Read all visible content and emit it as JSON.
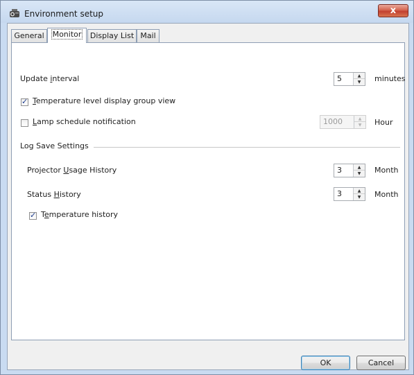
{
  "window": {
    "title": "Environment setup",
    "close_label": "x"
  },
  "tabs": [
    {
      "label": "General"
    },
    {
      "label": "Monitor"
    },
    {
      "label": "Display List"
    },
    {
      "label": "Mail"
    }
  ],
  "active_tab": "Monitor",
  "monitor": {
    "update_interval": {
      "label": "Update interval",
      "value": "5",
      "unit": "minutes"
    },
    "temperature_group_view": {
      "label": "Temperature level display group view",
      "checked": true
    },
    "lamp_schedule": {
      "label": "Lamp schedule notification",
      "checked": false,
      "value": "1000",
      "unit": "Hour",
      "enabled": false
    },
    "log_section_title": "Log Save Settings",
    "projector_usage": {
      "label": "Projector Usage History",
      "value": "3",
      "unit": "Month"
    },
    "status_history": {
      "label": "Status History",
      "value": "3",
      "unit": "Month"
    },
    "temperature_history": {
      "label": "Temperature history",
      "checked": true
    }
  },
  "buttons": {
    "ok": "OK",
    "cancel": "Cancel"
  },
  "icons": {
    "app": "projector-icon",
    "close": "close-icon",
    "checkmark": "✓"
  }
}
